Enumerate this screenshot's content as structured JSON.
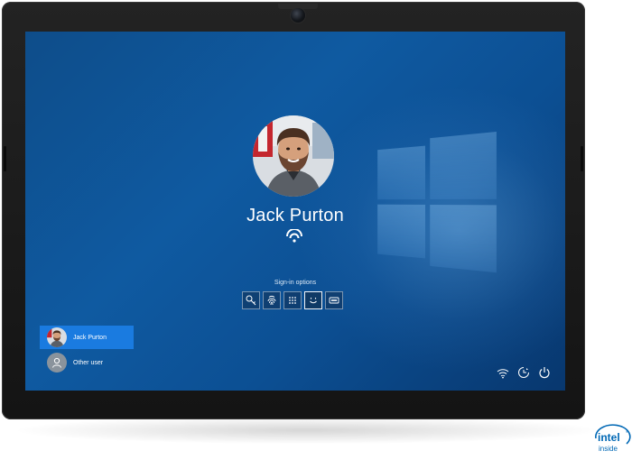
{
  "lock_screen": {
    "user_name": "Jack Purton",
    "signin_options_label": "Sign-in options",
    "signin_options": [
      {
        "name": "security-key-icon",
        "selected": false
      },
      {
        "name": "fingerprint-icon",
        "selected": false
      },
      {
        "name": "pin-icon",
        "selected": false
      },
      {
        "name": "face-recognition-icon",
        "selected": true
      },
      {
        "name": "password-icon",
        "selected": false
      }
    ]
  },
  "users": [
    {
      "label": "Jack Purton",
      "active": true,
      "icon": "user-photo"
    },
    {
      "label": "Other user",
      "active": false,
      "icon": "person-icon"
    }
  ],
  "system_tray": [
    {
      "name": "network-icon"
    },
    {
      "name": "accessibility-icon"
    },
    {
      "name": "power-icon"
    }
  ],
  "branding": {
    "logo_word": "intel",
    "logo_tag": "inside",
    "colors": {
      "accent": "#1a7be0",
      "intel": "#0068b5",
      "wallpaper": "#0f5aa1"
    }
  }
}
